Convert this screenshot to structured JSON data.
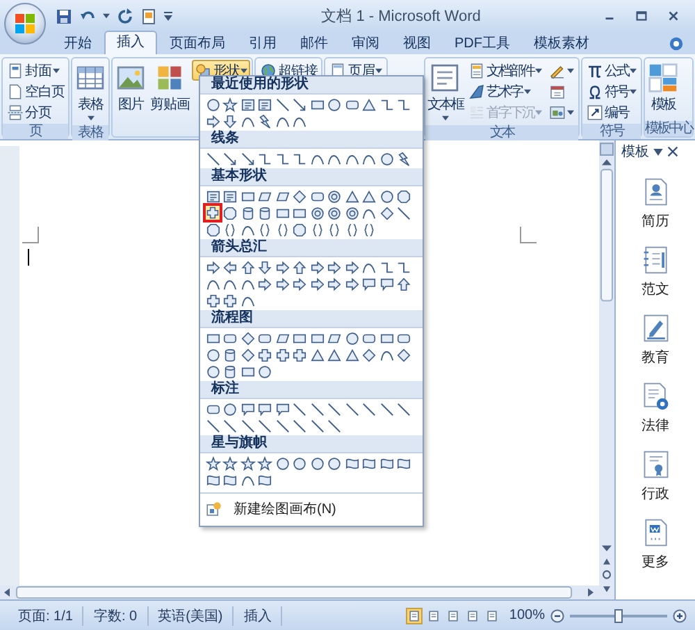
{
  "window": {
    "title": "文档 1 - Microsoft Word"
  },
  "tabs": [
    {
      "label": "开始",
      "selected": false
    },
    {
      "label": "插入",
      "selected": true
    },
    {
      "label": "页面布局",
      "selected": false
    },
    {
      "label": "引用",
      "selected": false
    },
    {
      "label": "邮件",
      "selected": false
    },
    {
      "label": "审阅",
      "selected": false
    },
    {
      "label": "视图",
      "selected": false
    },
    {
      "label": "PDF工具",
      "selected": false
    },
    {
      "label": "模板素材",
      "selected": false
    }
  ],
  "ribbon": {
    "groups": [
      {
        "label": "页",
        "columns": [
          [
            {
              "kind": "small",
              "label": "封面",
              "dropdown": true,
              "disabled": false,
              "open": false
            },
            {
              "kind": "small",
              "label": "空白页",
              "dropdown": false,
              "disabled": false,
              "open": false
            },
            {
              "kind": "small",
              "label": "分页",
              "dropdown": false,
              "disabled": false,
              "open": false
            }
          ]
        ]
      },
      {
        "label": "表格",
        "columns": [
          [
            {
              "kind": "large",
              "label": "表格",
              "dropdown": true,
              "disabled": false,
              "open": false
            }
          ]
        ]
      },
      {
        "columns": [
          [
            {
              "kind": "large",
              "label": "图片",
              "dropdown": false,
              "disabled": false,
              "open": false
            }
          ],
          [
            {
              "kind": "large",
              "label": "剪贴画",
              "dropdown": false,
              "disabled": false,
              "open": false
            }
          ],
          [
            {
              "kind": "small",
              "label": "形状",
              "dropdown": true,
              "disabled": false,
              "open": true
            }
          ]
        ]
      },
      {
        "columns": [
          [
            {
              "kind": "small",
              "label": "超链接",
              "dropdown": false,
              "disabled": false,
              "open": false
            }
          ]
        ]
      },
      {
        "columns": [
          [
            {
              "kind": "small",
              "label": "页眉",
              "dropdown": true,
              "disabled": false,
              "open": false
            }
          ]
        ]
      },
      {
        "label": "文本",
        "columns": [
          [
            {
              "kind": "large",
              "label": "文本框",
              "dropdown": true,
              "disabled": false,
              "open": false
            }
          ],
          [
            {
              "kind": "small",
              "label": "文档部件",
              "dropdown": true,
              "disabled": false,
              "open": false
            },
            {
              "kind": "small",
              "label": "艺术字",
              "dropdown": true,
              "disabled": false,
              "open": false
            },
            {
              "kind": "small",
              "label": "首字下沉",
              "dropdown": true,
              "disabled": true,
              "open": false
            }
          ],
          [
            {
              "kind": "icon",
              "dropdown": true,
              "disabled": false,
              "open": false
            },
            {
              "kind": "icon",
              "dropdown": false,
              "disabled": false,
              "open": false
            },
            {
              "kind": "icon",
              "dropdown": true,
              "disabled": false,
              "open": false
            }
          ]
        ]
      },
      {
        "label": "符号",
        "columns": [
          [
            {
              "kind": "small",
              "label": "公式",
              "dropdown": true,
              "disabled": false,
              "open": false
            },
            {
              "kind": "small",
              "label": "符号",
              "dropdown": true,
              "disabled": false,
              "open": false
            },
            {
              "kind": "small",
              "label": "编号",
              "dropdown": false,
              "disabled": false,
              "open": false
            }
          ]
        ]
      },
      {
        "label": "模板中心",
        "columns": [
          [
            {
              "kind": "large",
              "label": "模板",
              "dropdown": false,
              "disabled": false,
              "open": false
            }
          ]
        ]
      }
    ]
  },
  "shape_menu": {
    "sections": [
      {
        "title": "最近使用的形状",
        "marked": false
      },
      {
        "title": "线条",
        "marked": false
      },
      {
        "title": "基本形状",
        "marked": true
      },
      {
        "title": "箭头总汇",
        "marked": false
      },
      {
        "title": "流程图",
        "marked": false
      },
      {
        "title": "标注",
        "marked": false
      },
      {
        "title": "星与旗帜",
        "marked": false
      }
    ],
    "footer": "新建绘图画布(N)"
  },
  "task_pane": {
    "title": "模板",
    "items": [
      {
        "label": "简历"
      },
      {
        "label": "范文"
      },
      {
        "label": "教育"
      },
      {
        "label": "法律"
      },
      {
        "label": "行政"
      },
      {
        "label": "更多"
      }
    ]
  },
  "status_bar": {
    "items": [
      "页面: 1/1",
      "字数: 0",
      "英语(美国)",
      "插入"
    ],
    "view_buttons": [
      {
        "selected": true
      },
      {
        "selected": false
      },
      {
        "selected": false
      },
      {
        "selected": false
      },
      {
        "selected": false
      }
    ],
    "zoom": "100%",
    "zoom_level": {
      "level": 0.5
    }
  }
}
